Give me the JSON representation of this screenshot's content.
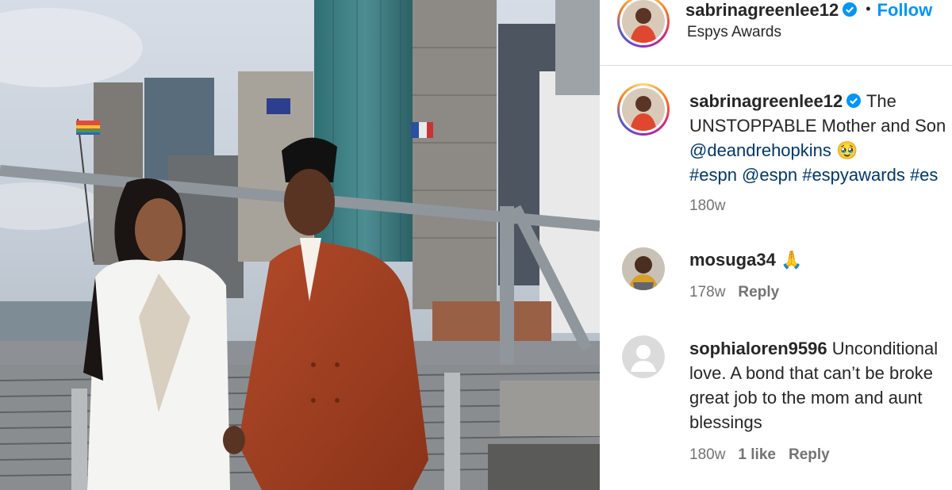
{
  "post": {
    "author": "sabrinagreenlee12",
    "follow_label": "Follow",
    "separator": "•",
    "location": "Espys Awards",
    "caption_line1": "The",
    "caption_line2": "UNSTOPPABLE Mother and Son",
    "caption_mention": "@deandrehopkins",
    "caption_emoji": "🥹",
    "caption_tags": "#espn @espn #espyawards #es",
    "time": "180w"
  },
  "comments": [
    {
      "user": "mosuga34",
      "text": "🙏",
      "time": "178w",
      "reply_label": "Reply"
    },
    {
      "user": "sophialoren9596",
      "line1": "Unconditional",
      "line2": "love. A bond that can’t be broke",
      "line3": "great job to the mom and aunt",
      "line4": "blessings",
      "time": "180w",
      "likes": "1 like",
      "reply_label": "Reply"
    }
  ],
  "colors": {
    "follow": "#0095f6",
    "link": "#00376b",
    "muted": "#737373",
    "verified": "#0095f6"
  }
}
